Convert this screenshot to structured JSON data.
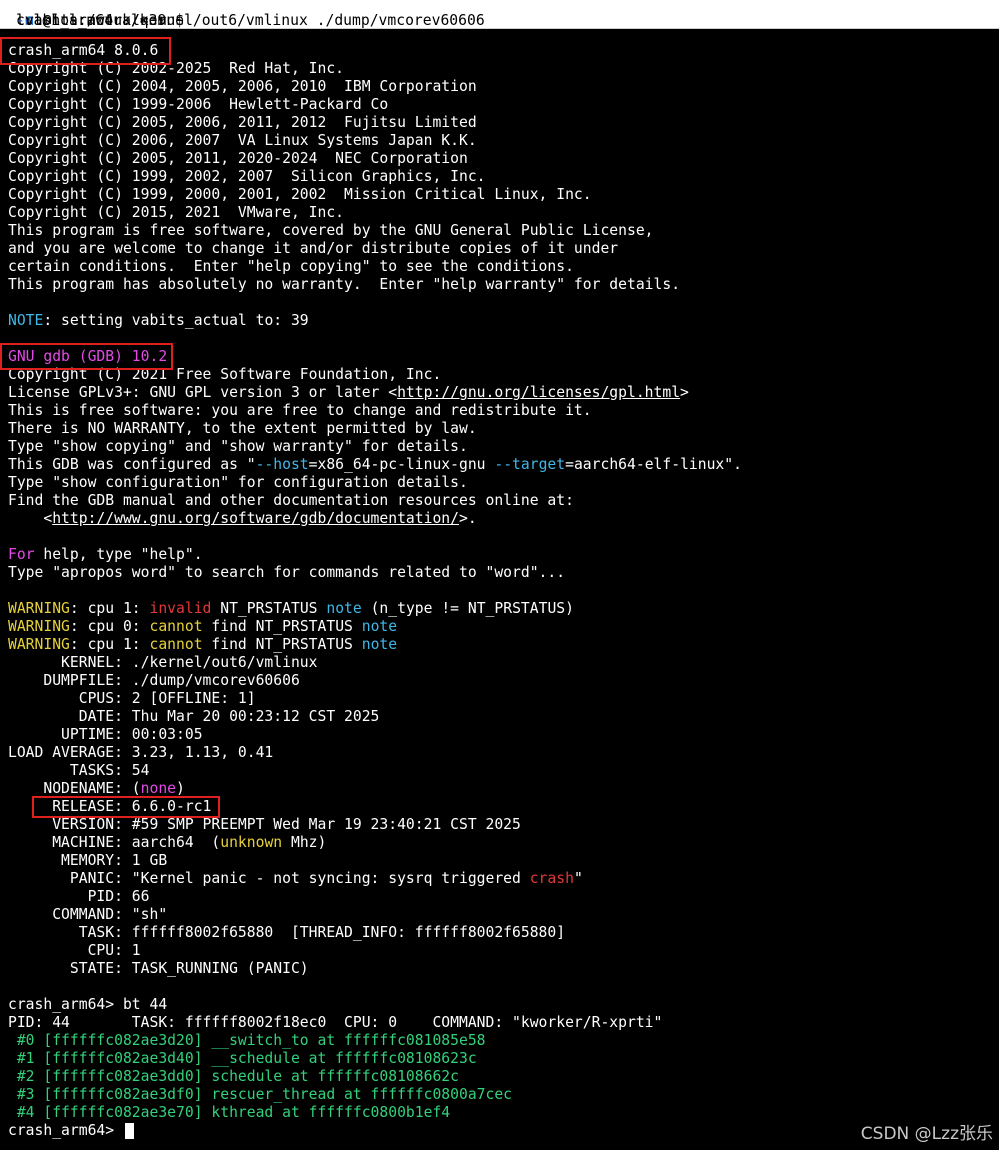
{
  "window": {
    "title_prompt": "lol@lol:/work/qemu$ ",
    "title_cmd": "crash_arm64 ./kernel/out6/vmlinux ./dump/vmcorev60606 ",
    "title_flag": "-m",
    "title_rest": " vabits_actual=39"
  },
  "colors": {
    "default": "#ffffff",
    "cyan": "#3fb7e6",
    "magenta": "#e24be6",
    "yellow": "#e6d13a",
    "red": "#e23838",
    "green": "#33d17a",
    "highlight_box": "#e0201e",
    "watermark": "#c8c8c8"
  },
  "lines": [
    [
      {
        "t": "crash_arm64 8.0.6"
      }
    ],
    [
      {
        "t": "Copyright (C) 2002-2025  Red Hat, Inc."
      }
    ],
    [
      {
        "t": "Copyright (C) 2004, 2005, 2006, 2010  IBM Corporation"
      }
    ],
    [
      {
        "t": "Copyright (C) 1999-2006  Hewlett-Packard Co"
      }
    ],
    [
      {
        "t": "Copyright (C) 2005, 2006, 2011, 2012  Fujitsu Limited"
      }
    ],
    [
      {
        "t": "Copyright (C) 2006, 2007  VA Linux Systems Japan K.K."
      }
    ],
    [
      {
        "t": "Copyright (C) 2005, 2011, 2020-2024  NEC Corporation"
      }
    ],
    [
      {
        "t": "Copyright (C) 1999, 2002, 2007  Silicon Graphics, Inc."
      }
    ],
    [
      {
        "t": "Copyright (C) 1999, 2000, 2001, 2002  Mission Critical Linux, Inc."
      }
    ],
    [
      {
        "t": "Copyright (C) 2015, 2021  VMware, Inc."
      }
    ],
    [
      {
        "t": "This program is free software, covered by the GNU General Public License,"
      }
    ],
    [
      {
        "t": "and you are welcome to change it and/or distribute copies of it under"
      }
    ],
    [
      {
        "t": "certain conditions.  Enter \"help copying\" to see the conditions."
      }
    ],
    [
      {
        "t": "This program has absolutely no warranty.  Enter \"help warranty\" for details."
      }
    ],
    [],
    [
      {
        "t": "NOTE",
        "c": "cyan"
      },
      {
        "t": ": setting vabits_actual to: 39"
      }
    ],
    [],
    [
      {
        "t": "GNU gdb (GDB) 10.2",
        "c": "magenta"
      }
    ],
    [
      {
        "t": "Copyright (C) 2021 Free Software Foundation, Inc."
      }
    ],
    [
      {
        "t": "License GPLv3+: GNU GPL version 3 or later <"
      },
      {
        "t": "http://gnu.org/licenses/gpl.html",
        "u": true
      },
      {
        "t": ">"
      }
    ],
    [
      {
        "t": "This is free software: you are free to change and redistribute it."
      }
    ],
    [
      {
        "t": "There is NO WARRANTY, to the extent permitted by law."
      }
    ],
    [
      {
        "t": "Type \"show copying\" and \"show warranty\" for details."
      }
    ],
    [
      {
        "t": "This GDB was configured as \""
      },
      {
        "t": "--host",
        "c": "cyan"
      },
      {
        "t": "=x86_64-pc-linux-gnu "
      },
      {
        "t": "--target",
        "c": "cyan"
      },
      {
        "t": "=aarch64-elf-linux\"."
      }
    ],
    [
      {
        "t": "Type \"show configuration\" for configuration details."
      }
    ],
    [
      {
        "t": "Find the GDB manual and other documentation resources online at:"
      }
    ],
    [
      {
        "t": "    <"
      },
      {
        "t": "http://www.gnu.org/software/gdb/documentation/",
        "u": true
      },
      {
        "t": ">."
      }
    ],
    [],
    [
      {
        "t": "For",
        "c": "magenta"
      },
      {
        "t": " help, type \"help\"."
      }
    ],
    [
      {
        "t": "Type \"apropos word\" to search for commands related to \"word\"..."
      }
    ],
    [],
    [
      {
        "t": "WARNING",
        "c": "yellow"
      },
      {
        "t": ": cpu 1: "
      },
      {
        "t": "invalid",
        "c": "red"
      },
      {
        "t": " NT_PRSTATUS "
      },
      {
        "t": "note",
        "c": "cyan"
      },
      {
        "t": " (n_type != NT_PRSTATUS)"
      }
    ],
    [
      {
        "t": "WARNING",
        "c": "yellow"
      },
      {
        "t": ": cpu 0: "
      },
      {
        "t": "cannot",
        "c": "yellow"
      },
      {
        "t": " find NT_PRSTATUS "
      },
      {
        "t": "note",
        "c": "cyan"
      }
    ],
    [
      {
        "t": "WARNING",
        "c": "yellow"
      },
      {
        "t": ": cpu 1: "
      },
      {
        "t": "cannot",
        "c": "yellow"
      },
      {
        "t": " find NT_PRSTATUS "
      },
      {
        "t": "note",
        "c": "cyan"
      }
    ],
    [
      {
        "t": "      KERNEL: ./kernel/out6/vmlinux"
      }
    ],
    [
      {
        "t": "    DUMPFILE: ./dump/vmcorev60606"
      }
    ],
    [
      {
        "t": "        CPUS: 2 [OFFLINE: 1]"
      }
    ],
    [
      {
        "t": "        DATE: Thu Mar 20 00:23:12 CST 2025"
      }
    ],
    [
      {
        "t": "      UPTIME: 00:03:05"
      }
    ],
    [
      {
        "t": "LOAD AVERAGE: 3.23, 1.13, 0.41"
      }
    ],
    [
      {
        "t": "       TASKS: 54"
      }
    ],
    [
      {
        "t": "    NODENAME: ("
      },
      {
        "t": "none",
        "c": "magenta"
      },
      {
        "t": ")"
      }
    ],
    [
      {
        "t": "     RELEASE: 6.6.0-rc1"
      }
    ],
    [
      {
        "t": "     VERSION: #59 SMP PREEMPT Wed Mar 19 23:40:21 CST 2025"
      }
    ],
    [
      {
        "t": "     MACHINE: aarch64  ("
      },
      {
        "t": "unknown",
        "c": "yellow"
      },
      {
        "t": " Mhz)"
      }
    ],
    [
      {
        "t": "      MEMORY: 1 GB"
      }
    ],
    [
      {
        "t": "       PANIC: \"Kernel panic - not syncing: sysrq triggered "
      },
      {
        "t": "crash",
        "c": "red"
      },
      {
        "t": "\""
      }
    ],
    [
      {
        "t": "         PID: 66"
      }
    ],
    [
      {
        "t": "     COMMAND: \"sh\""
      }
    ],
    [
      {
        "t": "        TASK: ffffff8002f65880  [THREAD_INFO: ffffff8002f65880]"
      }
    ],
    [
      {
        "t": "         CPU: 1"
      }
    ],
    [
      {
        "t": "       STATE: TASK_RUNNING (PANIC)"
      }
    ],
    [],
    [
      {
        "t": "crash_arm64> bt 44"
      }
    ],
    [
      {
        "t": "PID: 44       TASK: ffffff8002f18ec0  CPU: 0    COMMAND: \"kworker/R-xprti\""
      }
    ],
    [
      {
        "t": " #0 [ffffffc082ae3d20] __switch_to at ffffffc081085e58",
        "c": "green"
      }
    ],
    [
      {
        "t": " #1 [ffffffc082ae3d40] __schedule at ffffffc08108623c",
        "c": "green"
      }
    ],
    [
      {
        "t": " #2 [ffffffc082ae3dd0] schedule at ffffffc08108662c",
        "c": "green"
      }
    ],
    [
      {
        "t": " #3 [ffffffc082ae3df0] rescuer_thread at ffffffc0800a7cec",
        "c": "green"
      }
    ],
    [
      {
        "t": " #4 [ffffffc082ae3e70] kthread at ffffffc0800b1ef4",
        "c": "green"
      }
    ],
    [
      {
        "t": "crash_arm64> "
      }
    ]
  ],
  "watermark": "CSDN @Lzz张乐"
}
